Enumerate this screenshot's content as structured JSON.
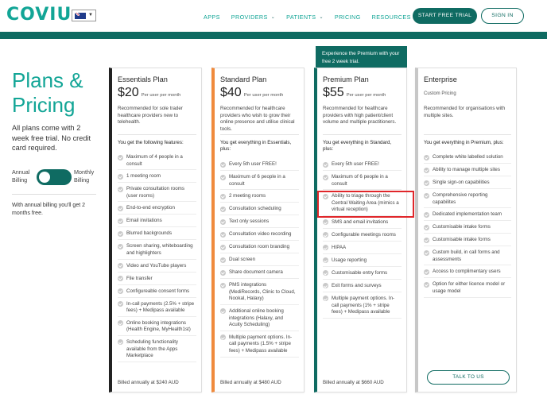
{
  "header": {
    "logo": "COVIU",
    "nav": [
      {
        "label": "APPS",
        "dropdown": false
      },
      {
        "label": "PROVIDERS",
        "dropdown": true
      },
      {
        "label": "PATIENTS",
        "dropdown": true
      },
      {
        "label": "PRICING",
        "dropdown": false
      },
      {
        "label": "RESOURCES & SUPPORT",
        "dropdown": true
      }
    ],
    "cta_trial": "START FREE TRIAL",
    "cta_signin": "SIGN IN"
  },
  "left": {
    "title_line1": "Plans &",
    "title_line2": "Pricing",
    "description": "All plans come with 2 week free trial. No credit card required.",
    "annual_label": "Annual Billing",
    "monthly_label": "Monthly Billing",
    "note": "With annual billing you'll get 2 months free."
  },
  "promo": "Experience the Premium with your free 2 week trial.",
  "plans": [
    {
      "name": "Essentials Plan",
      "price": "$20",
      "per": "Per user per month",
      "description": "Recommended for sole trader healthcare providers new to telehealth.",
      "features_heading": "You get the following features:",
      "features": [
        "Maximum of 4 people in a consult",
        "1 meeting room",
        "Private consultation rooms (user rooms)",
        "End-to-end encryption",
        "Email invitations",
        "Blurred backgrounds",
        "Screen sharing, whiteboarding and highlighters",
        "Video and YouTube players",
        "File transfer",
        "Configureable consent forms",
        "In-call payments (2.5% + stripe fees) + Medipass available",
        "Online booking integrations (Health Engine, MyHealth1st)",
        "Scheduling functionality available from the Apps Marketplace"
      ],
      "billed": "Billed annually at $240 AUD"
    },
    {
      "name": "Standard Plan",
      "price": "$40",
      "per": "Per user per month",
      "description": "Recommended for healthcare providers who wish to grow their online presence and utilise clinical tools.",
      "features_heading": "You get everything in Essentials, plus:",
      "features": [
        "Every 5th user FREE!",
        "Maximum of 6 people in a consult",
        "2 meeting rooms",
        "Consultation scheduling",
        "Text only sessions",
        "Consultation video recording",
        "Consultation room branding",
        "Dual screen",
        "Share document camera",
        "PMS integrations (MediRecords, Clinic to Cloud, Nookal, Halaxy)",
        "Additional online booking integrations (Halaxy, and Acuity Scheduling)",
        "Multiple payment options. In-call payments (1.5% + stripe fees) + Medipass available"
      ],
      "billed": "Billed annually at $480 AUD"
    },
    {
      "name": "Premium Plan",
      "price": "$55",
      "per": "Per user per month",
      "description": "Recommended for healthcare providers with high patient/client volume and multiple practitioners.",
      "features_heading": "You get everything in Standard, plus:",
      "features": [
        "Every 5th user FREE!",
        "Maximum of 6 people in a consult",
        "Ability to triage through the Central Waiting Area (mimics a virtual reception)",
        "SMS and email invitations",
        "Configurable meetings rooms",
        "HIPAA",
        "Usage reporting",
        "Customisable entry forms",
        "Exit forms and surveys",
        "Multiple payment options. In-call payments (1% + stripe fees) + Medipass available"
      ],
      "billed": "Billed annually at $660 AUD"
    },
    {
      "name": "Enterprise",
      "subtitle": "Custom Pricing",
      "description": "Recommended for organisations with multiple sites.",
      "features_heading": "You get everything in Premium, plus:",
      "features": [
        "Complete white labelled solution",
        "Ability to manage multiple sites",
        "Single sign-on capabilities",
        "Comprehensive reporting capabilites",
        "Dedicated implementation team",
        "Customisable intake forms",
        "Customisable intake forms",
        "Custom build, in call forms and assessments",
        "Access to complimentary users",
        "Option for either licence model or usage model"
      ],
      "cta": "TALK TO US"
    }
  ],
  "colors": {
    "brand_teal": "#12a596",
    "dark_teal": "#0f6b62",
    "essentials_accent": "#222222",
    "standard_accent": "#f08a3c",
    "premium_accent": "#0f6b62",
    "enterprise_accent": "#c7c7c7",
    "highlight_red": "#e0262a"
  }
}
